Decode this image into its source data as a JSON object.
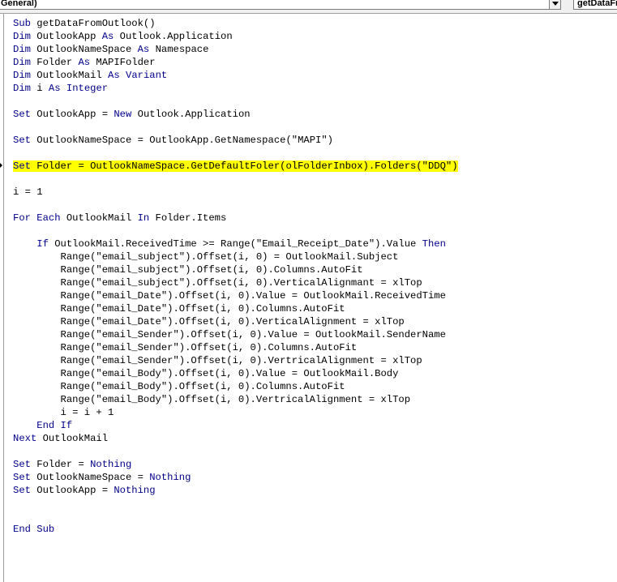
{
  "object_combo": {
    "value": "General)"
  },
  "procedure_combo": {
    "value": "getDataFr"
  },
  "code_lines": [
    [
      {
        "k": 1,
        "s": "Sub"
      },
      {
        "k": 0,
        "s": " getDataFromOutlook()"
      }
    ],
    [
      {
        "k": 1,
        "s": "Dim"
      },
      {
        "k": 0,
        "s": " OutlookApp "
      },
      {
        "k": 1,
        "s": "As"
      },
      {
        "k": 0,
        "s": " Outlook.Application"
      }
    ],
    [
      {
        "k": 1,
        "s": "Dim"
      },
      {
        "k": 0,
        "s": " OutlookNameSpace "
      },
      {
        "k": 1,
        "s": "As"
      },
      {
        "k": 0,
        "s": " Namespace"
      }
    ],
    [
      {
        "k": 1,
        "s": "Dim"
      },
      {
        "k": 0,
        "s": " Folder "
      },
      {
        "k": 1,
        "s": "As"
      },
      {
        "k": 0,
        "s": " MAPIFolder"
      }
    ],
    [
      {
        "k": 1,
        "s": "Dim"
      },
      {
        "k": 0,
        "s": " OutlookMail "
      },
      {
        "k": 1,
        "s": "As"
      },
      {
        "k": 0,
        "s": " "
      },
      {
        "k": 1,
        "s": "Variant"
      }
    ],
    [
      {
        "k": 1,
        "s": "Dim"
      },
      {
        "k": 0,
        "s": " i "
      },
      {
        "k": 1,
        "s": "As"
      },
      {
        "k": 0,
        "s": " "
      },
      {
        "k": 1,
        "s": "Integer"
      }
    ],
    [],
    [
      {
        "k": 1,
        "s": "Set"
      },
      {
        "k": 0,
        "s": " OutlookApp = "
      },
      {
        "k": 1,
        "s": "New"
      },
      {
        "k": 0,
        "s": " Outlook.Application"
      }
    ],
    [],
    [
      {
        "k": 1,
        "s": "Set"
      },
      {
        "k": 0,
        "s": " OutlookNameSpace = OutlookApp.GetNamespace(\"MAPI\")"
      }
    ],
    [],
    [
      {
        "k": 1,
        "s": "Set"
      },
      {
        "k": 0,
        "s": " Folder = OutlookNameSpace.GetDefaultFoler(olFolderInbox).Folders(\"DDQ\")"
      }
    ],
    [],
    [
      {
        "k": 0,
        "s": "i = 1"
      }
    ],
    [],
    [
      {
        "k": 1,
        "s": "For Each"
      },
      {
        "k": 0,
        "s": " OutlookMail "
      },
      {
        "k": 1,
        "s": "In"
      },
      {
        "k": 0,
        "s": " Folder.Items"
      }
    ],
    [],
    [
      {
        "k": 0,
        "s": "    "
      },
      {
        "k": 1,
        "s": "If"
      },
      {
        "k": 0,
        "s": " OutlookMail.ReceivedTime >= Range(\"Email_Receipt_Date\").Value "
      },
      {
        "k": 1,
        "s": "Then"
      }
    ],
    [
      {
        "k": 0,
        "s": "        Range(\"email_subject\").Offset(i, 0) = OutlookMail.Subject"
      }
    ],
    [
      {
        "k": 0,
        "s": "        Range(\"email_subject\").Offset(i, 0).Columns.AutoFit"
      }
    ],
    [
      {
        "k": 0,
        "s": "        Range(\"email_subject\").Offset(i, 0).VerticalAlignmant = xlTop"
      }
    ],
    [
      {
        "k": 0,
        "s": "        Range(\"email_Date\").Offset(i, 0).Value = OutlookMail.ReceivedTime"
      }
    ],
    [
      {
        "k": 0,
        "s": "        Range(\"email_Date\").Offset(i, 0).Columns.AutoFit"
      }
    ],
    [
      {
        "k": 0,
        "s": "        Range(\"email_Date\").Offset(i, 0).VerticalAlignment = xlTop"
      }
    ],
    [
      {
        "k": 0,
        "s": "        Range(\"email_Sender\").Offset(i, 0).Value = OutlookMail.SenderName"
      }
    ],
    [
      {
        "k": 0,
        "s": "        Range(\"email_Sender\").Offset(i, 0).Columns.AutoFit"
      }
    ],
    [
      {
        "k": 0,
        "s": "        Range(\"email_Sender\").Offset(i, 0).VertricalAlignment = xlTop"
      }
    ],
    [
      {
        "k": 0,
        "s": "        Range(\"email_Body\").Offset(i, 0).Value = OutlookMail.Body"
      }
    ],
    [
      {
        "k": 0,
        "s": "        Range(\"email_Body\").Offset(i, 0).Columns.AutoFit"
      }
    ],
    [
      {
        "k": 0,
        "s": "        Range(\"email_Body\").Offset(i, 0).VertricalAlignment = xlTop"
      }
    ],
    [
      {
        "k": 0,
        "s": "        i = i + 1"
      }
    ],
    [
      {
        "k": 0,
        "s": "    "
      },
      {
        "k": 1,
        "s": "End If"
      }
    ],
    [
      {
        "k": 1,
        "s": "Next"
      },
      {
        "k": 0,
        "s": " OutlookMail"
      }
    ],
    [],
    [
      {
        "k": 1,
        "s": "Set"
      },
      {
        "k": 0,
        "s": " Folder = "
      },
      {
        "k": 1,
        "s": "Nothing"
      }
    ],
    [
      {
        "k": 1,
        "s": "Set"
      },
      {
        "k": 0,
        "s": " OutlookNameSpace = "
      },
      {
        "k": 1,
        "s": "Nothing"
      }
    ],
    [
      {
        "k": 1,
        "s": "Set"
      },
      {
        "k": 0,
        "s": " OutlookApp = "
      },
      {
        "k": 1,
        "s": "Nothing"
      }
    ],
    [],
    [],
    [
      {
        "k": 1,
        "s": "End Sub"
      }
    ]
  ],
  "highlighted_line_index": 11,
  "colors": {
    "keyword": "#00008b",
    "text": "#000000",
    "highlight": "#ffff00"
  }
}
